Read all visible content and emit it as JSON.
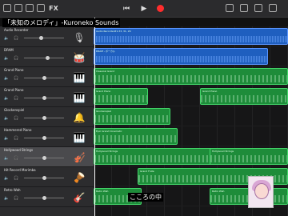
{
  "title_overlay": "「未知のメロディ」-Kuroneko Sounds",
  "subtitle": "こころの中",
  "toolbar": {
    "fx_label": "FX"
  },
  "tracks": [
    {
      "name": "Audio Recorder"
    },
    {
      "name": "DRAM"
    },
    {
      "name": "Grand Piano"
    },
    {
      "name": "Grand Piano"
    },
    {
      "name": "Glockenspiel"
    },
    {
      "name": "Hammered Piano"
    },
    {
      "name": "Hollywood Strings"
    },
    {
      "name": "Hit Record Marimba"
    },
    {
      "name": "Retro Wah"
    }
  ],
  "regions": [
    {
      "lane": 0,
      "label": "Audio Recorder#1.33, 31, 29",
      "kind": "audio"
    },
    {
      "lane": 1,
      "label": "DRAM - ボーカル",
      "kind": "audio"
    },
    {
      "lane": 2,
      "label": "Classical Grand",
      "kind": "midi"
    },
    {
      "lane": 3,
      "label": "Grand Piano",
      "kind": "midi"
    },
    {
      "lane": 3,
      "label": "Grand Piano",
      "kind": "midi"
    },
    {
      "lane": 4,
      "label": "Glockenspiel",
      "kind": "midi"
    },
    {
      "lane": 5,
      "label": "Epic Grand Cinematic",
      "kind": "midi"
    },
    {
      "lane": 6,
      "label": "Hollywood Strings",
      "kind": "midi"
    },
    {
      "lane": 6,
      "label": "Hollywood Strings",
      "kind": "midi"
    },
    {
      "lane": 7,
      "label": "Grand Flute",
      "kind": "midi"
    },
    {
      "lane": 8,
      "label": "Retro Wah",
      "kind": "midi"
    },
    {
      "lane": 8,
      "label": "Retro Wah",
      "kind": "midi"
    }
  ],
  "colors": {
    "audio": "#1f5fbf",
    "midi": "#1e8c3a",
    "record": "#ff2d2d"
  }
}
